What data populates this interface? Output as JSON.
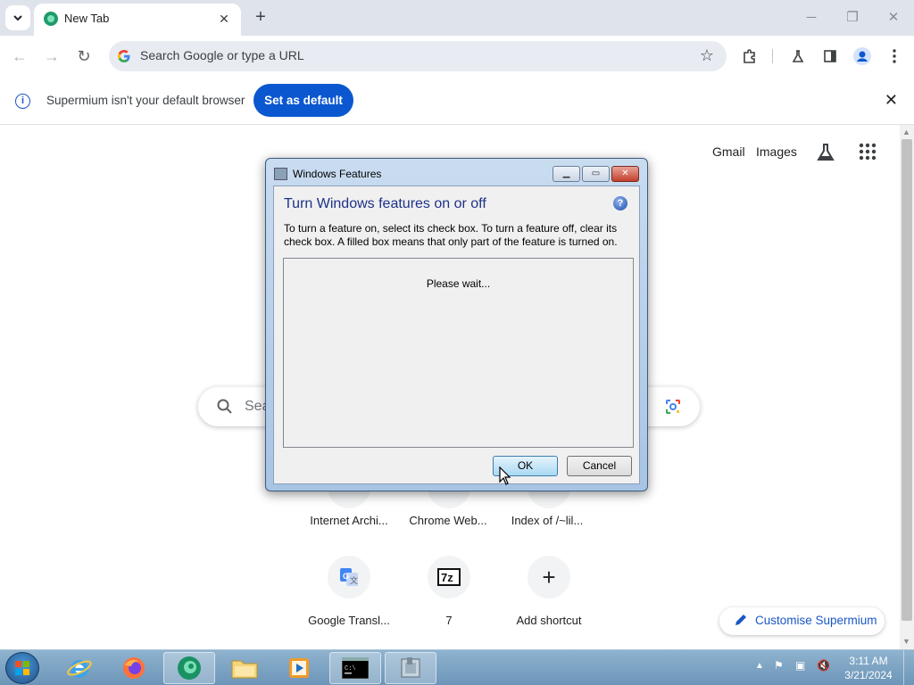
{
  "browser": {
    "tab": {
      "title": "New Tab"
    },
    "omnibox": {
      "placeholder": "Search Google or type a URL"
    },
    "infobar": {
      "message": "Supermium isn't your default browser",
      "button": "Set as default"
    }
  },
  "ntp": {
    "links": {
      "gmail": "Gmail",
      "images": "Images"
    },
    "search_placeholder": "Sea",
    "shortcuts": [
      {
        "label": "Internet Archi..."
      },
      {
        "label": "Chrome Web..."
      },
      {
        "label": "Index of /~lil..."
      },
      {
        "label": "Google Transl..."
      },
      {
        "label": "7"
      },
      {
        "label": "Add shortcut"
      }
    ],
    "customise": "Customise Supermium"
  },
  "dialog": {
    "title": "Windows Features",
    "heading": "Turn Windows features on or off",
    "description": "To turn a feature on, select its check box. To turn a feature off, clear its check box. A filled box means that only part of the feature is turned on.",
    "status": "Please wait...",
    "ok": "OK",
    "cancel": "Cancel"
  },
  "taskbar": {
    "time": "3:11 AM",
    "date": "3/21/2024"
  }
}
